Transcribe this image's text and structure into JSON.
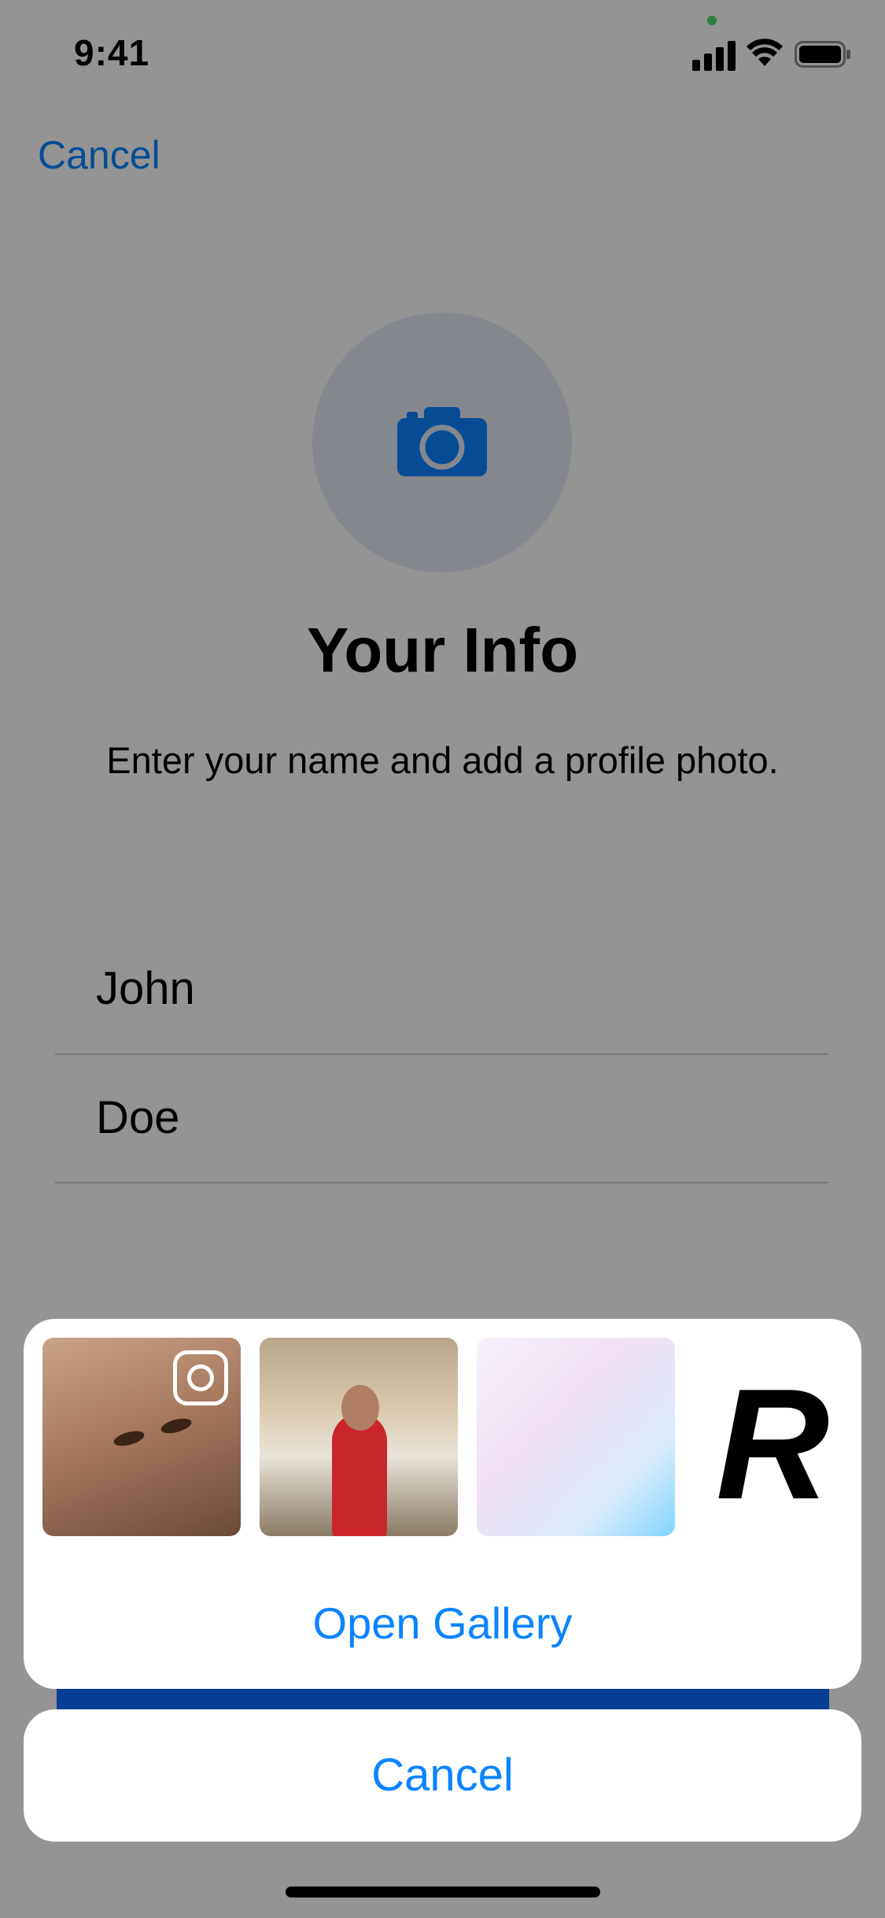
{
  "status_bar": {
    "time": "9:41"
  },
  "nav": {
    "cancel_label": "Cancel"
  },
  "profile": {
    "title": "Your Info",
    "subtitle": "Enter your name and add a profile photo.",
    "first_name": "John",
    "last_name": "Doe"
  },
  "action_sheet": {
    "thumbnails": [
      {
        "icon": "instagram-icon"
      },
      {},
      {},
      {
        "letter": "R"
      }
    ],
    "open_gallery_label": "Open Gallery",
    "cancel_label": "Cancel"
  },
  "colors": {
    "accent": "#0a84ff",
    "overlay": "rgba(0,0,0,0.42)",
    "sheet_bg": "#ffffff"
  }
}
